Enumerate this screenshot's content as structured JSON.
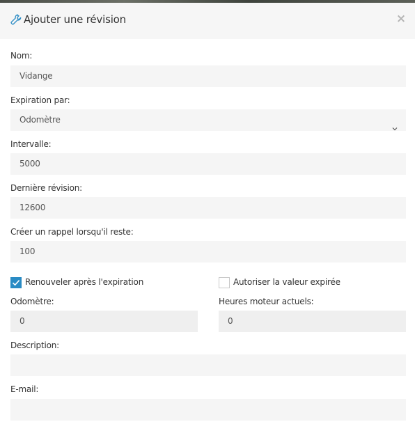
{
  "dialog": {
    "title": "Ajouter une révision",
    "header_icon": "wrench-icon",
    "close_icon": "close-icon",
    "close_label": "×"
  },
  "form": {
    "name": {
      "label": "Nom:",
      "value": "Vidange"
    },
    "expiration": {
      "label": "Expiration par:",
      "value": "Odomètre",
      "icon": "chevron-down-icon"
    },
    "interval": {
      "label": "Intervalle:",
      "value": "5000"
    },
    "last_revision": {
      "label": "Dernière révision:",
      "value": "12600"
    },
    "reminder": {
      "label": "Créer un rappel lorsqu'il reste:",
      "value": "100"
    },
    "renew": {
      "label": "Renouveler après l'expiration",
      "checked": true
    },
    "allow_expired": {
      "label": "Autoriser la valeur expirée",
      "checked": false
    },
    "odometer": {
      "label": "Odomètre:",
      "value": "0"
    },
    "engine_hours": {
      "label": "Heures moteur actuels:",
      "value": "0"
    },
    "description": {
      "label": "Description:",
      "value": ""
    },
    "email": {
      "label": "E-mail:",
      "value": ""
    }
  },
  "colors": {
    "accent": "#2a8bc4",
    "header_bg": "#f6f6f6",
    "field_bg": "#f5f5f5",
    "disabled_field_bg": "#efefef"
  }
}
